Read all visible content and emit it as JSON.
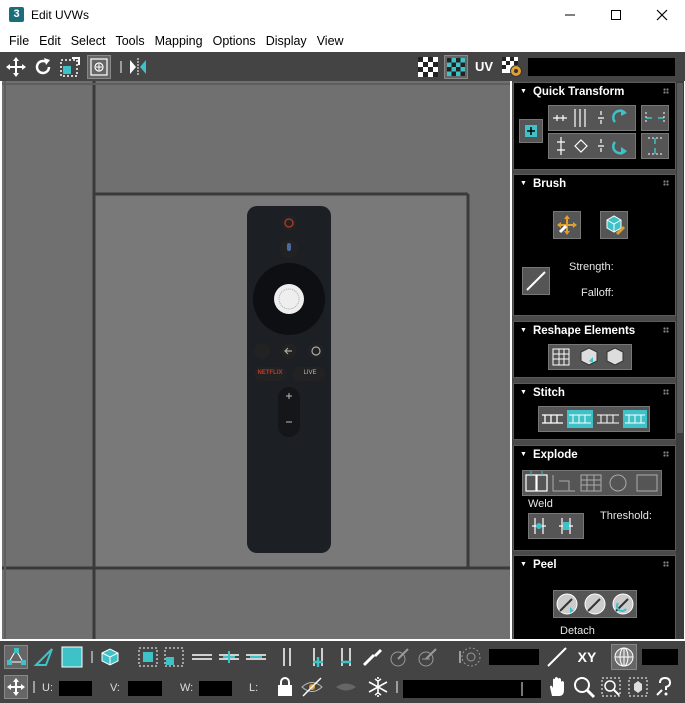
{
  "window": {
    "app_icon_text": "3",
    "title": "Edit UVWs"
  },
  "menu": [
    "File",
    "Edit",
    "Select",
    "Tools",
    "Mapping",
    "Options",
    "Display",
    "View"
  ],
  "toolbar": {
    "uv_label": "UV"
  },
  "panel": {
    "quick_transform": {
      "title": "Quick Transform"
    },
    "brush": {
      "title": "Brush",
      "strength_label": "Strength:",
      "falloff_label": "Falloff:"
    },
    "reshape": {
      "title": "Reshape Elements"
    },
    "stitch": {
      "title": "Stitch"
    },
    "explode": {
      "title": "Explode",
      "weld_label": "Weld",
      "threshold_label": "Threshold:"
    },
    "peel": {
      "title": "Peel",
      "detach_label": "Detach"
    }
  },
  "remote": {
    "netflix_label": "NETFLIX",
    "live_label": "LIVE"
  },
  "bottom": {
    "xy_label": "XY",
    "u_label": "U:",
    "v_label": "V:",
    "w_label": "W:",
    "l_label": "L:"
  },
  "colors": {
    "accent": "#3ec1c7",
    "toolbar_bg": "#444444",
    "viewport_bg": "#707070",
    "panel_bg": "#000000"
  }
}
